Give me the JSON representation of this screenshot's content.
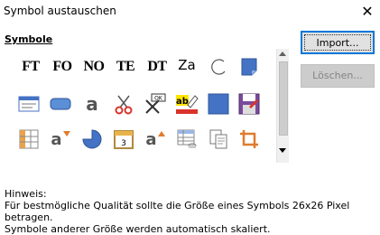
{
  "window": {
    "title": "Symbol austauschen",
    "close_glyph": "✕"
  },
  "section": {
    "title": "Symbole"
  },
  "buttons": {
    "import_label": "Import...",
    "delete_label": "Löschen..."
  },
  "symbols": {
    "row1": [
      {
        "name": "ft-text-icon",
        "label": "FT"
      },
      {
        "name": "fo-text-icon",
        "label": "FO"
      },
      {
        "name": "no-text-icon",
        "label": "NO"
      },
      {
        "name": "te-text-icon",
        "label": "TE"
      },
      {
        "name": "dt-text-icon",
        "label": "DT"
      },
      {
        "name": "za-text-icon",
        "label": "Za"
      },
      {
        "name": "arc-icon"
      },
      {
        "name": "note-page-icon"
      }
    ],
    "row2": [
      {
        "name": "form-list-icon"
      },
      {
        "name": "rounded-rectangle-icon"
      },
      {
        "name": "letter-a-icon",
        "label": "a"
      },
      {
        "name": "scissors-icon"
      },
      {
        "name": "ok-tools-icon",
        "label": "OK"
      },
      {
        "name": "highlighter-ab-icon",
        "label": "ab"
      },
      {
        "name": "blue-square-icon"
      },
      {
        "name": "save-as-icon"
      }
    ],
    "row3": [
      {
        "name": "grid-layout-icon"
      },
      {
        "name": "letter-a-down-icon",
        "label": "a"
      },
      {
        "name": "pie-shape-icon"
      },
      {
        "name": "calendar-icon",
        "label": "3"
      },
      {
        "name": "letter-a-up-icon",
        "label": "a"
      },
      {
        "name": "table-data-icon"
      },
      {
        "name": "copy-pages-icon"
      },
      {
        "name": "crop-icon"
      }
    ]
  },
  "hint": {
    "heading": "Hinweis:",
    "line1": "Für bestmögliche Qualität sollte die Größe eines Symbols 26x26 Pixel betragen.",
    "line2": "Symbole anderer Größe werden automatisch skaliert."
  },
  "colors": {
    "accent": "#0078d7",
    "red": "#d9342b",
    "blue": "#4472c4"
  }
}
